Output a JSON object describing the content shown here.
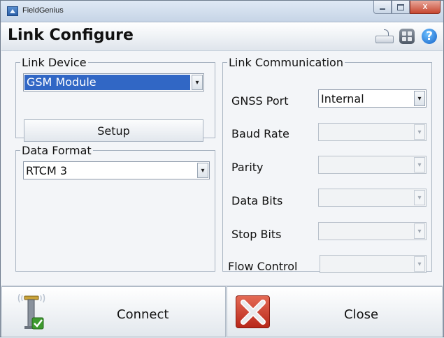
{
  "window": {
    "title": "FieldGenius",
    "controls": {
      "minimize": "minimize",
      "maximize": "maximize",
      "close": "X"
    }
  },
  "header": {
    "title": "Link Configure",
    "icons": [
      "keyboard-icon",
      "menu-grid-icon",
      "help-icon"
    ],
    "help_glyph": "?"
  },
  "link_device": {
    "legend": "Link Device",
    "device": {
      "value": "GSM Module",
      "selected": true
    },
    "setup_button": "Setup"
  },
  "data_format": {
    "legend": "Data Format",
    "value": "RTCM 3"
  },
  "link_communication": {
    "legend": "Link Communication",
    "fields": [
      {
        "label": "GNSS Port",
        "value": "Internal",
        "enabled": true
      },
      {
        "label": "Baud Rate",
        "value": "",
        "enabled": false
      },
      {
        "label": "Parity",
        "value": "",
        "enabled": false
      },
      {
        "label": "Data Bits",
        "value": "",
        "enabled": false
      },
      {
        "label": "Stop Bits",
        "value": "",
        "enabled": false
      },
      {
        "label": "Flow Control",
        "value": "",
        "enabled": false
      }
    ]
  },
  "footer": {
    "connect_label": "Connect",
    "close_label": "Close",
    "icons": {
      "connect": "radio-antenna-check-icon",
      "close": "red-x-icon"
    }
  },
  "colors": {
    "selection": "#3167c5",
    "close_red": "#c7462f",
    "check_green": "#3e9a2f"
  }
}
